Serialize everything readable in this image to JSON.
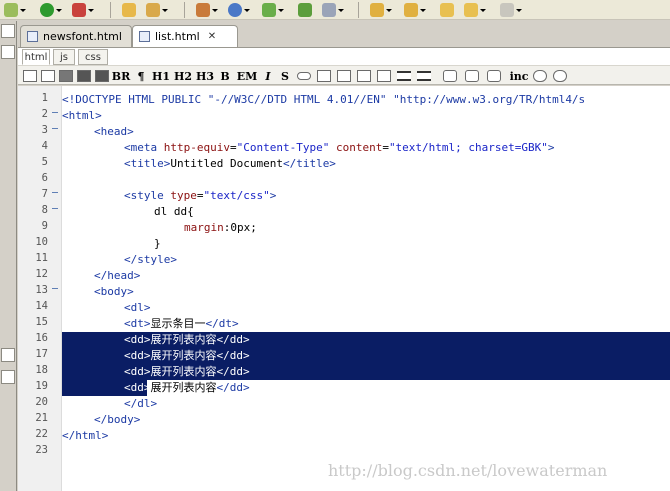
{
  "editor_tabs": [
    {
      "label": "newsfont.html",
      "active": false
    },
    {
      "label": "list.html",
      "active": true
    }
  ],
  "sub_tabs": [
    "html",
    "js",
    "css"
  ],
  "format_toolbar": [
    "BR",
    "¶",
    "H1",
    "H2",
    "H3",
    "B",
    "EM",
    "I",
    "S",
    "inc"
  ],
  "code": {
    "line_numbers": [
      "1",
      "2",
      "3",
      "4",
      "5",
      "6",
      "7",
      "8",
      "9",
      "10",
      "11",
      "12",
      "13",
      "14",
      "15",
      "16",
      "17",
      "18",
      "19",
      "20",
      "21",
      "22",
      "23"
    ],
    "l1": "<!DOCTYPE HTML PUBLIC \"-//W3C//DTD HTML 4.01//EN\" \"http://www.w3.org/TR/html4/s",
    "l2": "<html>",
    "l3": "<head>",
    "l4_tag": "<meta",
    "l4_a1": "http-equiv",
    "l4_v1": "\"Content-Type\"",
    "l4_a2": "content",
    "l4_v2": "\"text/html; charset=GBK\"",
    "l4_end": ">",
    "l5_open": "<title>",
    "l5_text": "Untitled Document",
    "l5_close": "</title>",
    "l7_tag": "<style",
    "l7_a": "type",
    "l7_v": "\"text/css\"",
    "l7_end": ">",
    "l8": "dl dd{",
    "l9_prop": "margin",
    "l9_val": ":0px;",
    "l10": "}",
    "l11": "</style>",
    "l12": "</head>",
    "l13": "<body>",
    "l14": "<dl>",
    "l15_open": "<dt>",
    "l15_text": "显示条目一",
    "l15_close": "</dt>",
    "dd_open": "<dd>",
    "dd_text": "展开列表内容",
    "dd_close": "</dd>",
    "l20": "</dl>",
    "l21": "</body>",
    "l22": "</html>"
  },
  "watermark": "http://blog.csdn.net/lovewaterman"
}
